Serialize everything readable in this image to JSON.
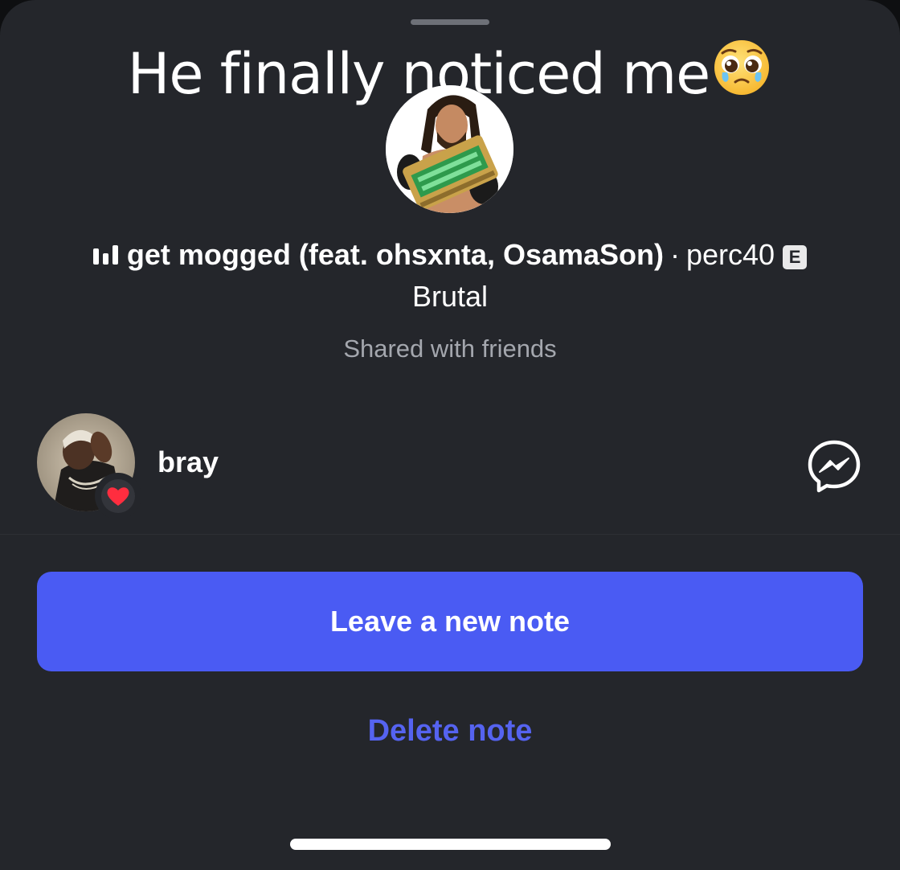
{
  "note": {
    "caption": "He finally noticed me",
    "emoji_icon": "pleading-face-emoji"
  },
  "song": {
    "icon": "equalizer-icon",
    "title": "get mogged (feat. ohsxnta, OsamaSon)",
    "separator": "·",
    "artist": "perc40",
    "explicit_badge": "E",
    "album": "Brutal"
  },
  "audience": {
    "label": "Shared with friends"
  },
  "reply": {
    "name": "bray",
    "reaction_icon": "heart-icon",
    "reaction_color": "#ff2d3f",
    "action_icon": "messenger-icon"
  },
  "actions": {
    "primary_label": "Leave a new note",
    "primary_color": "#4a5bf3",
    "secondary_label": "Delete note",
    "secondary_color": "#5563f0"
  }
}
